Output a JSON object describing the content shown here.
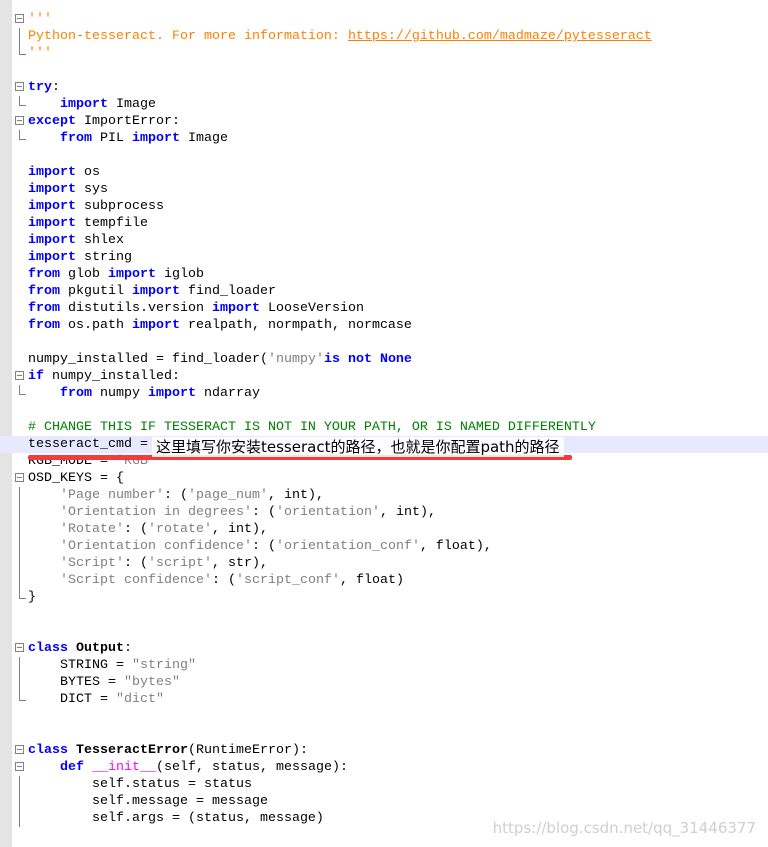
{
  "colors": {
    "keyword": "#0000ff",
    "string": "#808080",
    "comment": "#008000",
    "docstring": "#ff8000",
    "magic": "#ff00ff",
    "highlight": "#e8e8ff",
    "annotation_underline": "#f03c3c"
  },
  "lines": [
    {
      "fold": "open",
      "t": [
        [
          "doc",
          "'''"
        ]
      ]
    },
    {
      "fold": "line",
      "t": [
        [
          "doc",
          "Python-tesseract. For more information: "
        ],
        [
          "url",
          "https://github.com/madmaze/pytesseract"
        ]
      ]
    },
    {
      "fold": "end",
      "t": [
        [
          "doc",
          "'''"
        ]
      ]
    },
    {
      "t": []
    },
    {
      "fold": "open",
      "t": [
        [
          "kw",
          "try"
        ],
        [
          "",
          ":"
        ]
      ]
    },
    {
      "fold": "end",
      "t": [
        [
          "",
          "    "
        ],
        [
          "kw",
          "import"
        ],
        [
          "",
          " Image"
        ]
      ]
    },
    {
      "fold": "open",
      "t": [
        [
          "kw",
          "except"
        ],
        [
          "",
          " ImportError:"
        ]
      ]
    },
    {
      "fold": "end",
      "t": [
        [
          "",
          "    "
        ],
        [
          "kw",
          "from"
        ],
        [
          "",
          " PIL "
        ],
        [
          "kw",
          "import"
        ],
        [
          "",
          " Image"
        ]
      ]
    },
    {
      "t": []
    },
    {
      "t": [
        [
          "kw",
          "import"
        ],
        [
          "",
          " os"
        ]
      ]
    },
    {
      "t": [
        [
          "kw",
          "import"
        ],
        [
          "",
          " sys"
        ]
      ]
    },
    {
      "t": [
        [
          "kw",
          "import"
        ],
        [
          "",
          " subprocess"
        ]
      ]
    },
    {
      "t": [
        [
          "kw",
          "import"
        ],
        [
          "",
          " tempfile"
        ]
      ]
    },
    {
      "t": [
        [
          "kw",
          "import"
        ],
        [
          "",
          " shlex"
        ]
      ]
    },
    {
      "t": [
        [
          "kw",
          "import"
        ],
        [
          "",
          " string"
        ]
      ]
    },
    {
      "t": [
        [
          "kw",
          "from"
        ],
        [
          "",
          " glob "
        ],
        [
          "kw",
          "import"
        ],
        [
          "",
          " iglob"
        ]
      ]
    },
    {
      "t": [
        [
          "kw",
          "from"
        ],
        [
          "",
          " pkgutil "
        ],
        [
          "kw",
          "import"
        ],
        [
          "",
          " find_loader"
        ]
      ]
    },
    {
      "t": [
        [
          "kw",
          "from"
        ],
        [
          "",
          " distutils.version "
        ],
        [
          "kw",
          "import"
        ],
        [
          "",
          " LooseVersion"
        ]
      ]
    },
    {
      "t": [
        [
          "kw",
          "from"
        ],
        [
          "",
          " os.path "
        ],
        [
          "kw",
          "import"
        ],
        [
          "",
          " realpath, normpath, normcase"
        ]
      ]
    },
    {
      "t": []
    },
    {
      "t": [
        [
          "",
          "numpy_installed = find_loader("
        ],
        [
          "str",
          "'numpy'"
        ],
        [
          ") "
        ],
        [
          "kw",
          "is not None"
        ]
      ]
    },
    {
      "fold": "open",
      "t": [
        [
          "kw",
          "if"
        ],
        [
          "",
          " numpy_installed:"
        ]
      ]
    },
    {
      "fold": "end",
      "t": [
        [
          "",
          "    "
        ],
        [
          "kw",
          "from"
        ],
        [
          "",
          " numpy "
        ],
        [
          "kw",
          "import"
        ],
        [
          "",
          " ndarray"
        ]
      ]
    },
    {
      "t": []
    },
    {
      "t": [
        [
          "com",
          "# CHANGE THIS IF TESSERACT IS NOT IN YOUR PATH, OR IS NAMED DIFFERENTLY"
        ]
      ]
    },
    {
      "hl": true,
      "t": [
        [
          "",
          "tesseract_cmd = "
        ]
      ]
    },
    {
      "t": [
        [
          "",
          "RGB_MODE = "
        ],
        [
          "str",
          "'RGB'"
        ]
      ]
    },
    {
      "fold": "open",
      "t": [
        [
          "",
          "OSD_KEYS = {"
        ]
      ]
    },
    {
      "fold": "line",
      "t": [
        [
          "",
          "    "
        ],
        [
          "str",
          "'Page number'"
        ],
        [
          "",
          ": ("
        ],
        [
          "str",
          "'page_num'"
        ],
        [
          "",
          ", int),"
        ]
      ]
    },
    {
      "fold": "line",
      "t": [
        [
          "",
          "    "
        ],
        [
          "str",
          "'Orientation in degrees'"
        ],
        [
          "",
          ": ("
        ],
        [
          "str",
          "'orientation'"
        ],
        [
          "",
          ", int),"
        ]
      ]
    },
    {
      "fold": "line",
      "t": [
        [
          "",
          "    "
        ],
        [
          "str",
          "'Rotate'"
        ],
        [
          "",
          ": ("
        ],
        [
          "str",
          "'rotate'"
        ],
        [
          "",
          ", int),"
        ]
      ]
    },
    {
      "fold": "line",
      "t": [
        [
          "",
          "    "
        ],
        [
          "str",
          "'Orientation confidence'"
        ],
        [
          "",
          ": ("
        ],
        [
          "str",
          "'orientation_conf'"
        ],
        [
          "",
          ", float),"
        ]
      ]
    },
    {
      "fold": "line",
      "t": [
        [
          "",
          "    "
        ],
        [
          "str",
          "'Script'"
        ],
        [
          "",
          ": ("
        ],
        [
          "str",
          "'script'"
        ],
        [
          "",
          ", str),"
        ]
      ]
    },
    {
      "fold": "line",
      "t": [
        [
          "",
          "    "
        ],
        [
          "str",
          "'Script confidence'"
        ],
        [
          "",
          ": ("
        ],
        [
          "str",
          "'script_conf'"
        ],
        [
          "",
          ", float)"
        ]
      ]
    },
    {
      "fold": "end",
      "t": [
        [
          "",
          "}"
        ]
      ]
    },
    {
      "t": []
    },
    {
      "t": []
    },
    {
      "fold": "open",
      "t": [
        [
          "kw",
          "class"
        ],
        [
          "kwb",
          " Output"
        ],
        [
          "",
          ":"
        ]
      ]
    },
    {
      "fold": "line",
      "t": [
        [
          "",
          "    STRING = "
        ],
        [
          "str",
          "\"string\""
        ]
      ]
    },
    {
      "fold": "line",
      "t": [
        [
          "",
          "    BYTES = "
        ],
        [
          "str",
          "\"bytes\""
        ]
      ]
    },
    {
      "fold": "end",
      "t": [
        [
          "",
          "    DICT = "
        ],
        [
          "str",
          "\"dict\""
        ]
      ]
    },
    {
      "t": []
    },
    {
      "t": []
    },
    {
      "fold": "open",
      "t": [
        [
          "kw",
          "class"
        ],
        [
          "",
          " "
        ],
        [
          "b",
          "TesseractError"
        ],
        [
          "",
          "(RuntimeError):"
        ]
      ]
    },
    {
      "fold": "open",
      "t": [
        [
          "",
          "    "
        ],
        [
          "kw",
          "def"
        ],
        [
          "",
          " "
        ],
        [
          "magic",
          "__init__"
        ],
        [
          "",
          "(self, status, message):"
        ]
      ]
    },
    {
      "fold": "line",
      "t": [
        [
          "",
          "        self.status = status"
        ]
      ]
    },
    {
      "fold": "line",
      "t": [
        [
          "",
          "        self.message = message"
        ]
      ]
    },
    {
      "fold": "line",
      "t": [
        [
          "",
          "        self.args = (status, message)"
        ]
      ]
    }
  ],
  "annotation": "这里填写你安装tesseract的路径，也就是你配置path的路径",
  "watermark": "https://blog.csdn.net/qq_31446377"
}
